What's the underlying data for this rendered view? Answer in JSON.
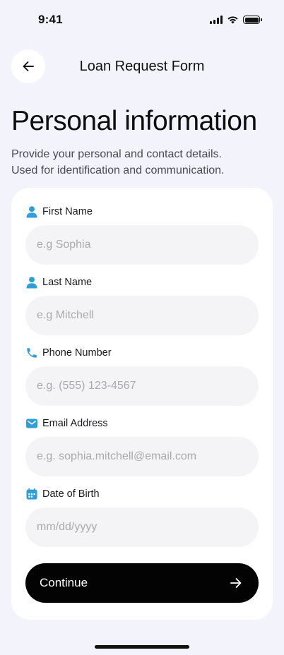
{
  "status_bar": {
    "time": "9:41"
  },
  "header": {
    "title": "Loan Request Form"
  },
  "page": {
    "title": "Personal information",
    "description_line1": "Provide your personal and contact details.",
    "description_line2": "Used for identification and communication."
  },
  "form": {
    "fields": [
      {
        "label": "First Name",
        "placeholder": "e.g Sophia",
        "value": "",
        "icon": "person-icon"
      },
      {
        "label": "Last Name",
        "placeholder": "e.g Mitchell",
        "value": "",
        "icon": "person-icon"
      },
      {
        "label": "Phone Number",
        "placeholder": "e.g. (555) 123-4567",
        "value": "",
        "icon": "phone-icon"
      },
      {
        "label": "Email Address",
        "placeholder": "e.g. sophia.mitchell@email.com",
        "value": "",
        "icon": "mail-icon"
      },
      {
        "label": "Date of Birth",
        "placeholder": "mm/dd/yyyy",
        "value": "",
        "icon": "calendar-icon"
      }
    ],
    "submit_label": "Continue"
  },
  "colors": {
    "accent": "#2f9fd6",
    "background": "#f3f3fc",
    "card": "#ffffff",
    "input_bg": "#f4f4f7",
    "button_bg": "#030303"
  }
}
